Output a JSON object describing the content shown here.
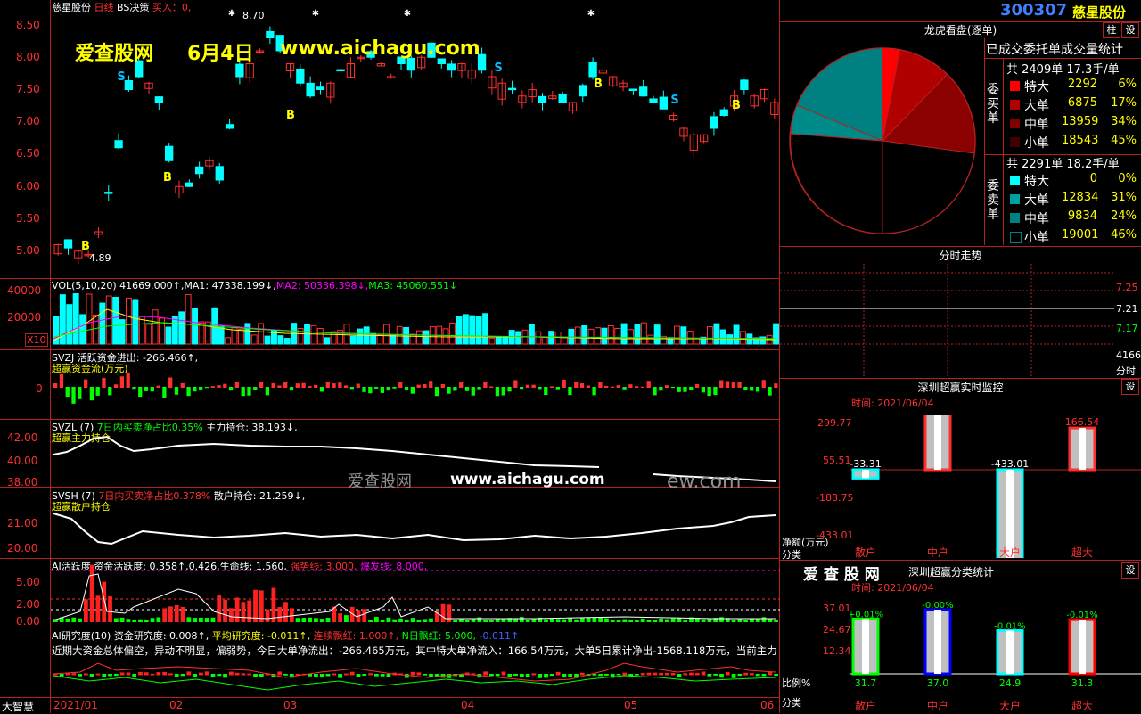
{
  "header": {
    "stock_name": "慈星股份",
    "period": "日线",
    "bs_label": "BS决策",
    "buy_label": "买入：0,",
    "watermark_site": "爱查股网",
    "watermark_date": "6月4日",
    "watermark_url": "www.aichagu.com",
    "peak_marker": "8.70",
    "low_marker": "4.89"
  },
  "price_axis": [
    "8.50",
    "8.00",
    "7.50",
    "7.00",
    "6.50",
    "6.00",
    "5.50",
    "5.00"
  ],
  "indicators": {
    "vol_line": "VOL(5,10,20)  41669.000↑,MA1: 47338.199↓,MA2: 50336.398↓,MA3: 45060.551↓",
    "vol_parts": {
      "p1": "VOL(5,10,20)  41669.000↑,",
      "p2": "MA1: 47338.199↓,",
      "p3": "MA2: 50336.398↓,",
      "p4": "MA3: 45060.551↓"
    },
    "vol_axis": [
      "40000",
      "20000"
    ],
    "vol_unit": "X10",
    "svzj_title": "SVZJ  活跃资金进出: -266.466↑,",
    "svzj_sub": "超赢资金流(万元)",
    "svzj_axis": "0",
    "svzl_title_a": "SVZL (7)",
    "svzl_title_b": "7日内买卖净占比0.35%",
    "svzl_title_c": "主力持仓: 38.193↓,",
    "svzl_sub": "超赢主力持仓",
    "svzl_axis": [
      "42.00",
      "40.00",
      "38.00"
    ],
    "svsh_title_a": "SVSH (7)",
    "svsh_title_b": "7日内买卖净占比0.378%",
    "svsh_title_c": "散户持仓: 21.259↓,",
    "svsh_sub": "超赢散户持仓",
    "svsh_axis": [
      "21.00",
      "20.00"
    ],
    "mid_watermark_site": "爱查股网",
    "mid_watermark_url": "www.aichagu.com",
    "mid_watermark_tail": "ew.com",
    "ai_title_a": "AI活跃度 资金活跃度: 0.358↑,0.426,生命线: 1.560,",
    "ai_title_b": "强势线: 3.000,",
    "ai_title_c": "爆发线: 8.000,",
    "ai_axis": [
      "5.00",
      "2.00",
      "0.00"
    ],
    "air_title_a": "AI研究度(10) 资金研究度: 0.008↑,",
    "air_title_b": "平均研究度: -0.011↑,",
    "air_title_c": "连续飘红: 1.000↑,",
    "air_title_d": "N日飘红: 5.000,",
    "air_title_e": "-0.011↑",
    "air_text": "近期大资金总体偏空，异动不明显，偏弱势，今日大单净流出：-266.465万元，其中特大单净流入：166.54万元，大单5日累计净出-1568.118万元，当前主力"
  },
  "xaxis": {
    "label_left": "大智慧",
    "dates": [
      "2021/01",
      "02",
      "03",
      "04",
      "05",
      "06"
    ]
  },
  "right": {
    "code": "300307",
    "name": "慈星股份",
    "btn_zhu": "柱",
    "btn_settings": "设",
    "pie_title": "龙虎看盘(逐单)",
    "stats_title": "已成交委托单成交量统计",
    "buy_side": "委买单",
    "buy_total": "共 2409单 17.3手/单",
    "buy_rows": [
      {
        "name": "特大",
        "count": "2292",
        "pct": "6%",
        "color": "#ff0000"
      },
      {
        "name": "大单",
        "count": "6875",
        "pct": "17%",
        "color": "#b00000"
      },
      {
        "name": "中单",
        "count": "13959",
        "pct": "34%",
        "color": "#800000"
      },
      {
        "name": "小单",
        "count": "18543",
        "pct": "45%",
        "color": "#400000"
      }
    ],
    "sell_side": "委卖单",
    "sell_total": "共 2291单 18.2手/单",
    "sell_rows": [
      {
        "name": "特大",
        "count": "0",
        "pct": "0%",
        "color": "#00ffff"
      },
      {
        "name": "大单",
        "count": "12834",
        "pct": "31%",
        "color": "#00a0a0"
      },
      {
        "name": "中单",
        "count": "9834",
        "pct": "24%",
        "color": "#008080"
      },
      {
        "name": "小单",
        "count": "19001",
        "pct": "46%",
        "color": "#000000"
      }
    ],
    "intraday_title": "分时走势",
    "intraday_axis": [
      "7.25",
      "7.21",
      "7.17"
    ],
    "intraday_vol": "41669",
    "intraday_vol_label": "分时",
    "monitor_title": "深圳超赢实时监控",
    "monitor_time": "时间: 2021/06/04",
    "monitor_axis": [
      "299.77",
      "55.51",
      "-188.75",
      "-433.01"
    ],
    "monitor_unit": "净额(万元)",
    "monitor_cat": "分类",
    "monitor_bars": [
      {
        "label": "散户",
        "value": "-33.31",
        "num": -33.31
      },
      {
        "label": "中户",
        "value": "299.77",
        "num": 299.77
      },
      {
        "label": "大户",
        "value": "-433.01",
        "num": -433.01
      },
      {
        "label": "超大",
        "value": "166.54",
        "num": 166.54
      }
    ],
    "brand": "爱 查 股 网",
    "class_title": "深圳超赢分类统计",
    "class_time": "时间: 2021/06/04",
    "class_axis": [
      "37.01",
      "24.67",
      "12.34"
    ],
    "class_ratio": "比例%",
    "class_cat": "分类",
    "class_bars": [
      {
        "label": "散户",
        "pct": "+0.01%",
        "val": "31.7",
        "num": 31.7,
        "color": "#00ff00"
      },
      {
        "label": "中户",
        "pct": "-0.00%",
        "val": "37.0",
        "num": 37.0,
        "color": "#0000ff"
      },
      {
        "label": "大户",
        "pct": "-0.01%",
        "val": "24.9",
        "num": 24.9,
        "color": "#00ffff"
      },
      {
        "label": "超大",
        "pct": "-0.01%",
        "val": "31.3",
        "num": 31.3,
        "color": "#ff0000"
      }
    ]
  },
  "chart_data": {
    "type": "table",
    "title": "",
    "monitor": {
      "categories": [
        "散户",
        "中户",
        "大户",
        "超大"
      ],
      "values": [
        -33.31,
        299.77,
        -433.01,
        166.54
      ]
    },
    "classification": {
      "categories": [
        "散户",
        "中户",
        "大户",
        "超大"
      ],
      "values": [
        31.7,
        37.0,
        24.9,
        31.3
      ]
    },
    "buy_distribution": {
      "categories": [
        "特大",
        "大单",
        "中单",
        "小单"
      ],
      "values": [
        6,
        17,
        34,
        45
      ]
    },
    "sell_distribution": {
      "categories": [
        "特大",
        "大单",
        "中单",
        "小单"
      ],
      "values": [
        0,
        31,
        24,
        46
      ]
    }
  },
  "colors": {
    "up": "#ff3030",
    "down": "#00ffff",
    "grid": "#b22222",
    "accent": "#ffff00"
  }
}
